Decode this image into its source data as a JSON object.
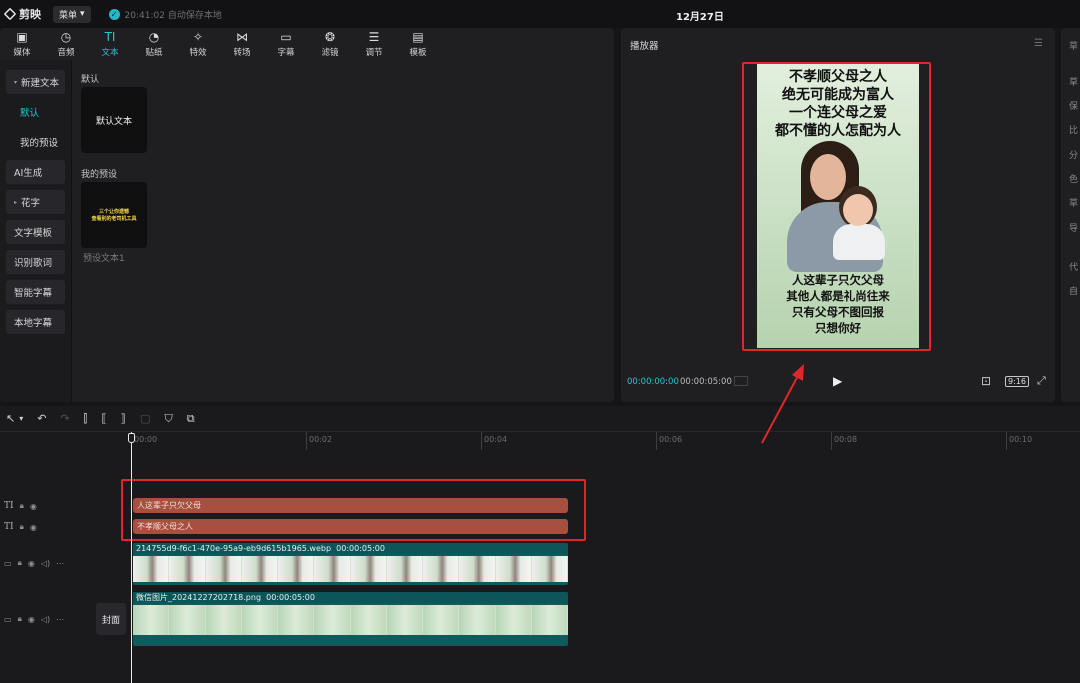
{
  "app": {
    "name": "剪映",
    "menu_label": "菜单",
    "save_status": "20:41:02 自动保存本地",
    "date": "12月27日"
  },
  "toolbar": {
    "items": [
      {
        "label": "媒体",
        "icon": "media-icon"
      },
      {
        "label": "音频",
        "icon": "audio-icon"
      },
      {
        "label": "文本",
        "icon": "text-icon",
        "active": true
      },
      {
        "label": "贴纸",
        "icon": "sticker-icon"
      },
      {
        "label": "特效",
        "icon": "effects-icon"
      },
      {
        "label": "转场",
        "icon": "transition-icon"
      },
      {
        "label": "字幕",
        "icon": "subtitle-icon"
      },
      {
        "label": "滤镜",
        "icon": "filter-icon"
      },
      {
        "label": "调节",
        "icon": "adjust-icon"
      },
      {
        "label": "模板",
        "icon": "template-icon"
      }
    ]
  },
  "side_nav": {
    "items": [
      "新建文本",
      "默认",
      "我的预设",
      "AI生成",
      "花字",
      "文字模板",
      "识别歌词",
      "智能字幕",
      "本地字幕"
    ]
  },
  "text_panel": {
    "default_section": "默认",
    "default_card": "默认文本",
    "preset_section": "我的预设",
    "preset_card_lines": [
      "三个让你遗憾",
      "查看别的老司机工具"
    ],
    "preset_name": "预设文本1"
  },
  "player": {
    "title": "播放器",
    "current_time": "00:00:00:00",
    "total_time": "00:00:05:00",
    "ratio": "9:16",
    "preview_top_lines": [
      "不孝顺父母之人",
      "绝无可能成为富人",
      "一个连父母之爱",
      "都不懂的人怎配为人"
    ],
    "preview_bottom_lines": [
      "人这辈子只欠父母",
      "其他人都是礼尚往来",
      "只有父母不图回报",
      "只想你好"
    ]
  },
  "right_panel": {
    "items": [
      "草",
      "草",
      "保",
      "比",
      "分",
      "色",
      "草",
      "导",
      "代",
      "自"
    ]
  },
  "timeline": {
    "ruler_labels": [
      "00:00",
      "00:02",
      "00:04",
      "00:06",
      "00:08",
      "00:10"
    ],
    "text_clip_1": "人这辈子只欠父母",
    "text_clip_2": "不孝顺父母之人",
    "video_clip_1_name": "214755d9-f6c1-470e-95a9-eb9d615b1965.webp",
    "video_clip_1_duration": "00:00:05:00",
    "video_clip_2_name": "微信图片_20241227202718.png",
    "video_clip_2_duration": "00:00:05:00",
    "cover_label": "封面"
  },
  "colors": {
    "accent": "#1fc7d4",
    "text_clip": "#a7503f",
    "video_clip": "#0e5a5d",
    "highlight_red": "#e0262a"
  }
}
